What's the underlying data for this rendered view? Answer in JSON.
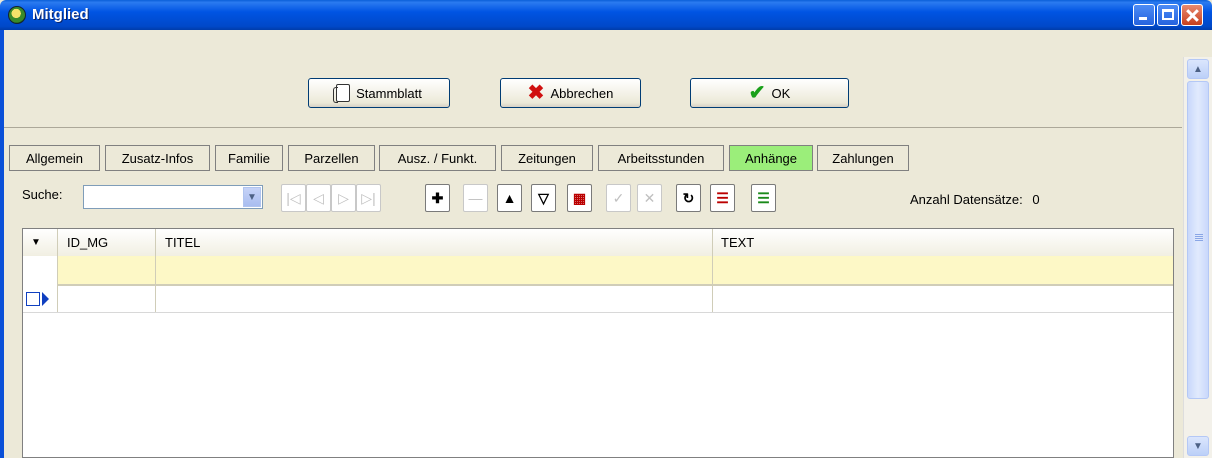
{
  "window": {
    "title": "Mitglied",
    "icon": "app-logo-icon"
  },
  "actions": {
    "stammblatt": "Stammblatt",
    "abbrechen": "Abbrechen",
    "ok": "OK"
  },
  "tabs": [
    {
      "label": "Allgemein"
    },
    {
      "label": "Zusatz-Infos"
    },
    {
      "label": "Familie"
    },
    {
      "label": "Parzellen"
    },
    {
      "label": "Ausz. / Funkt."
    },
    {
      "label": "Zeitungen"
    },
    {
      "label": "Arbeitsstunden"
    },
    {
      "label": "Anhänge",
      "active": true
    },
    {
      "label": "Zahlungen"
    }
  ],
  "search": {
    "label": "Suche:",
    "value": ""
  },
  "toolbar": {
    "icons": [
      "first-record-icon",
      "prev-record-icon",
      "next-record-icon",
      "last-record-icon",
      "add-record-icon",
      "delete-record-icon",
      "sort-icon",
      "filter-icon",
      "export-grid-icon",
      "post-icon",
      "cancel-edit-icon",
      "refresh-icon",
      "list-add-icon",
      "list-insert-icon"
    ]
  },
  "count": {
    "label": "Anzahl Datensätze:",
    "value": "0"
  },
  "grid": {
    "columns": [
      "ID_MG",
      "TITEL",
      "TEXT"
    ],
    "rows": []
  },
  "colors": {
    "active_tab": "#9bee7a",
    "filter_row": "#fdf8c6",
    "titlebar": "#0054e3"
  }
}
